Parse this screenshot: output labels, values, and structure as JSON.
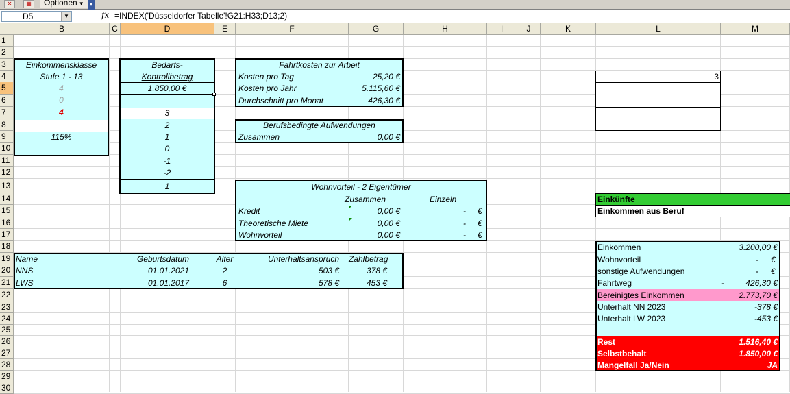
{
  "toolbar": {
    "options_label": "Optionen"
  },
  "formula_bar": {
    "name_box": "D5",
    "fx": "fx",
    "formula": "=INDEX('Düsseldorfer Tabelle'!G21:H33;D13;2)"
  },
  "columns": [
    "B",
    "C",
    "D",
    "E",
    "F",
    "G",
    "H",
    "I",
    "J",
    "K",
    "L",
    "M"
  ],
  "rows": [
    "1",
    "2",
    "3",
    "4",
    "5",
    "6",
    "7",
    "8",
    "9",
    "10",
    "11",
    "12",
    "13",
    "14",
    "15",
    "16",
    "17",
    "18",
    "19",
    "20",
    "21",
    "22",
    "23",
    "24",
    "25",
    "26",
    "27",
    "28",
    "29",
    "30"
  ],
  "income_class": {
    "title1": "Einkommensklasse",
    "title2": "Stufe 1 - 13",
    "v5": "4",
    "v6": "0",
    "v7": "4",
    "pct": "115%"
  },
  "bedarf": {
    "title1": "Bedarfs-",
    "title2": "Kontrollbetrag",
    "amount": "1.850,00 €",
    "values": [
      "3",
      "2",
      "1",
      "0",
      "-1",
      "-2"
    ],
    "result": "1"
  },
  "fahrtkosten": {
    "title": "Fahrtkosten zur Arbeit",
    "rows": [
      {
        "label": "Kosten pro Tag",
        "value": "25,20 €"
      },
      {
        "label": "Kosten pro Jahr",
        "value": "5.115,60 €"
      },
      {
        "label": "Durchschnitt pro Monat",
        "value": "426,30 €"
      }
    ]
  },
  "berufsbedingt": {
    "title": "Berufsbedingte Aufwendungen",
    "label": "Zusammen",
    "value": "0,00 €"
  },
  "wohnvorteil": {
    "title": "Wohnvorteil - 2 Eigentümer",
    "col1": "Zusammen",
    "col2": "Einzeln",
    "rows": [
      {
        "label": "Kredit",
        "total": "0,00 €",
        "single": "-",
        "unit": "€"
      },
      {
        "label": "Theoretische Miete",
        "total": "0,00 €",
        "single": "-",
        "unit": "€"
      },
      {
        "label": "Wohnvorteil",
        "total": "0,00 €",
        "single": "-",
        "unit": "€"
      }
    ]
  },
  "children": {
    "headers": [
      "Name",
      "Geburtsdatum",
      "Alter",
      "Unterhaltsanspruch",
      "Zahlbetrag"
    ],
    "rows": [
      [
        "NNS",
        "01.01.2021",
        "2",
        "503 €",
        "378 €"
      ],
      [
        "LWS",
        "01.01.2017",
        "6",
        "578 €",
        "453 €"
      ]
    ]
  },
  "l_input": "3",
  "income": {
    "header1": "Einkünfte",
    "header2": "Einkommen aus Beruf",
    "einkommen_label": "Einkommen",
    "einkommen": "3.200,00 €",
    "wohnvorteil_label": "Wohnvorteil",
    "wohnvorteil": "-",
    "wohnvorteil_unit": "€",
    "sonstige_label": "sonstige Aufwendungen",
    "sonstige": "-",
    "sonstige_unit": "€",
    "fahrtweg_label": "Fahrtweg",
    "fahrtweg_sign": "-",
    "fahrtweg": "426,30 €",
    "bereinigt_label": "Bereinigtes Einkommen",
    "bereinigt": "2.773,70 €",
    "nn_label": "Unterhalt NN 2023",
    "nn": "-378 €",
    "lw_label": "Unterhalt LW 2023",
    "lw": "-453 €",
    "rest_label": "Rest",
    "rest": "1.516,40 €",
    "selbst_label": "Selbstbehalt",
    "selbst": "1.850,00 €",
    "mangel_label": "Mangelfall Ja/Nein",
    "mangel": "JA"
  },
  "colors": {
    "cyan": "#ccffff",
    "green": "#33cc33",
    "pink": "#ff99cc",
    "red": "#ff0000",
    "header_selected": "#f8c27c"
  }
}
